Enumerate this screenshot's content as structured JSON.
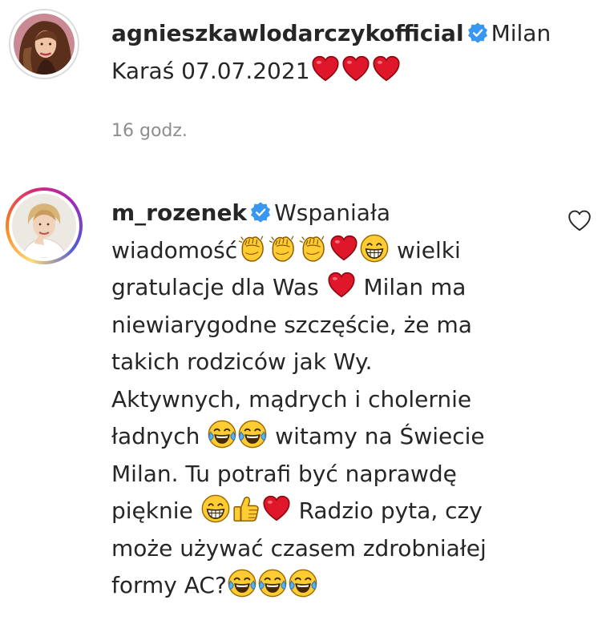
{
  "comments": [
    {
      "username": "agnieszkawlodarczykofficial",
      "verified": true,
      "text_lines": [
        "Milan",
        "Karaś 07.07.2021"
      ],
      "timestamp": "16 godz."
    },
    {
      "username": "m_rozenek",
      "verified": true,
      "text_lines": [
        "Wspaniała",
        "wiadomość",
        "wielki",
        "gratulacje dla Was",
        "Milan ma",
        "niewiarygodne szczęście, że ma",
        "takich rodziców jak Wy.",
        "Aktywnych, mądrych i cholernie",
        "ładnych",
        "witamy na Świecie",
        "Milan. Tu potrafi być naprawdę",
        "pięknie",
        "Radzio pyta, czy",
        "może używać czasem zdrobniałej",
        "formy AC?"
      ]
    }
  ],
  "icons": {
    "verified": "verified-badge-icon",
    "heart": "red-heart-emoji",
    "clap": "clapping-hands-emoji",
    "grin": "grinning-face-emoji",
    "joy": "face-with-tears-of-joy-emoji",
    "thumbs": "thumbs-up-emoji",
    "like": "heart-outline-icon"
  },
  "colors": {
    "text": "#262626",
    "muted": "#8e8e8e",
    "verified": "#3897f0",
    "heart": "#e0162b"
  }
}
